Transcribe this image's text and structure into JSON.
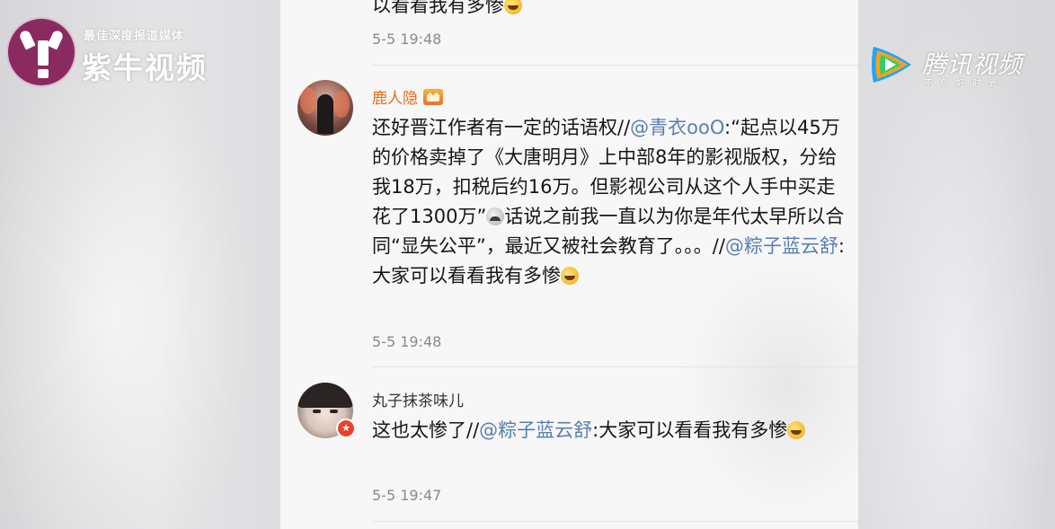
{
  "watermarks": {
    "left_logo": {
      "tagline": "最佳深度报道媒体",
      "name": "紫牛视频"
    },
    "right_logo": {
      "name": "腾讯视频",
      "slogan": "不负好时光"
    }
  },
  "comments": [
    {
      "partial": true,
      "body_tail": "以看看我有多惨",
      "emoji": "laugh-cry-emoji",
      "time": "5-5 19:48"
    },
    {
      "username": "鹿人隐",
      "vip": true,
      "body": {
        "text1": "还好晋江作者有一定的话语权//",
        "mention1": "@青衣ooO",
        "text2": ":“起点以45万的价格卖掉了《大唐明月》上中部8年的影视版权，分给我18万，扣税后约16万。但影视公司从这个人手中买走花了1300万”",
        "text3": "话说之前我一直以为你是年代太早所以合同“显失公平”，最近又被社会教育了。。。//",
        "mention2": "@粽子蓝云舒",
        "text4": ":大家可以看看我有多惨"
      },
      "emojis": [
        "sad-emoji",
        "laugh-cry-emoji"
      ],
      "time": "5-5 19:48"
    },
    {
      "username": "丸子抹茶味儿",
      "vip": false,
      "badge": "verified-badge",
      "body": {
        "text1": "这也太惨了//",
        "mention1": "@粽子蓝云舒",
        "text2": ":大家可以看看我有多惨"
      },
      "emojis": [
        "laugh-cry-emoji"
      ],
      "time": "5-5 19:47"
    }
  ],
  "colors": {
    "vip_username": "#ea6b16",
    "mention": "#5a7fae",
    "timestamp": "#8a8a8a",
    "logo_left_bg": "#8b2a5f"
  }
}
